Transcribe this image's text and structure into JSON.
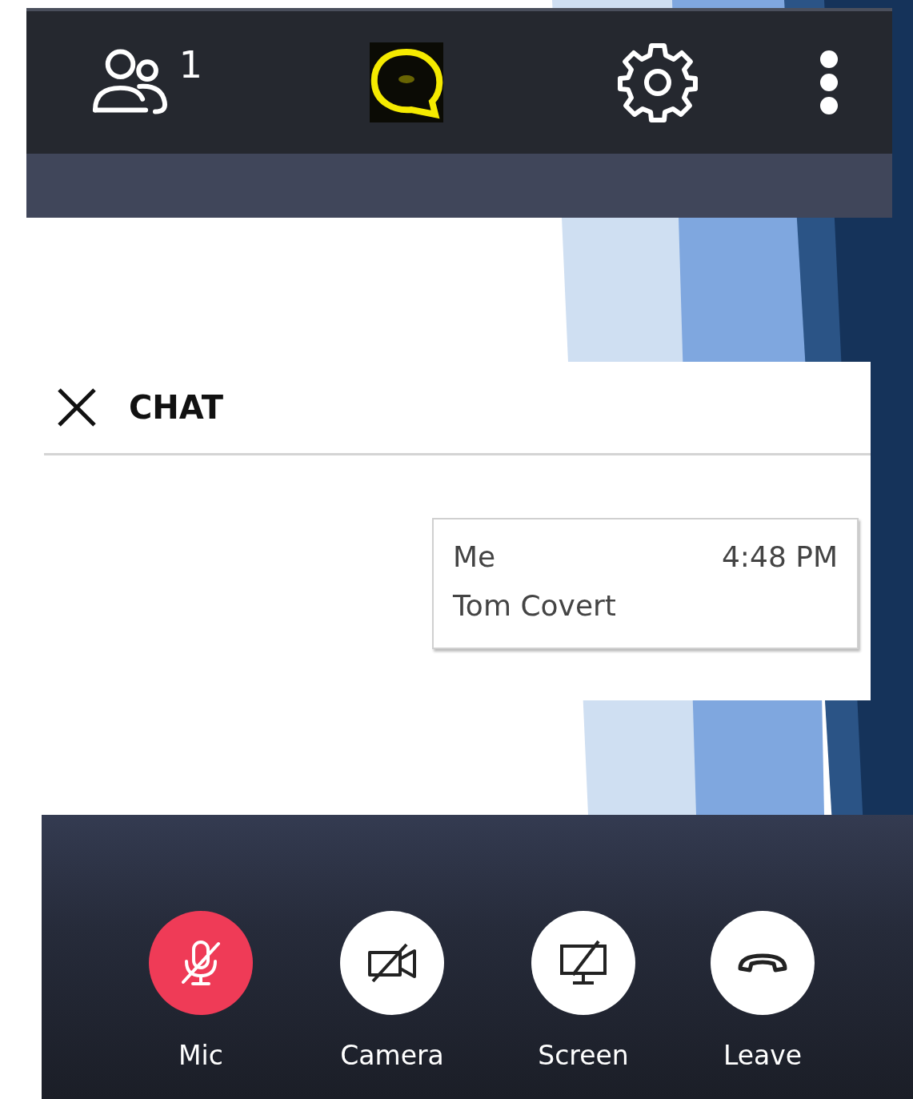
{
  "toolbar": {
    "participant_count": "1",
    "chat_highlighted": true
  },
  "chat": {
    "title": "CHAT",
    "messages": [
      {
        "sender": "Me",
        "time": "4:48 PM",
        "text": "Tom Covert"
      }
    ]
  },
  "controls": [
    {
      "kind": "mic",
      "label": "Mic",
      "highlighted": true
    },
    {
      "kind": "camera",
      "label": "Camera",
      "highlighted": false
    },
    {
      "kind": "screen",
      "label": "Screen",
      "highlighted": false
    },
    {
      "kind": "leave",
      "label": "Leave",
      "highlighted": false
    }
  ]
}
